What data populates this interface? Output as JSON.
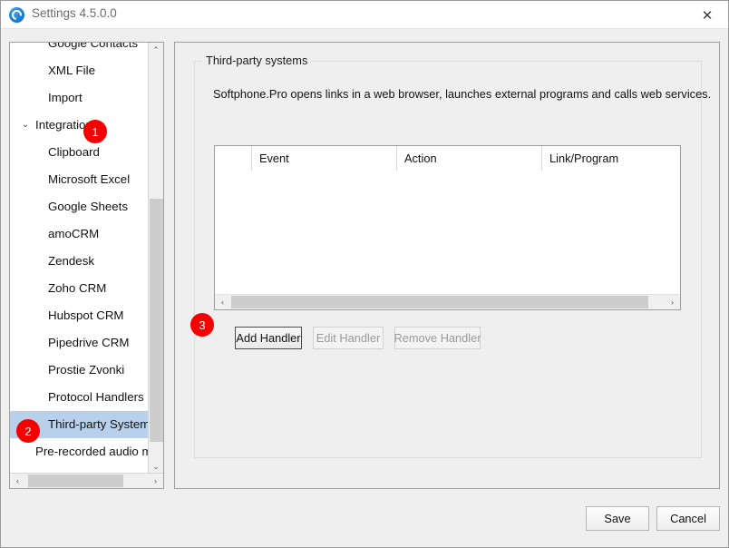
{
  "window": {
    "title": "Settings 4.5.0.0",
    "app_icon": "headset-icon",
    "close_label": "✕"
  },
  "sidebar": {
    "items": [
      {
        "label": "Google Contacts",
        "level": 1,
        "chevron": "",
        "selected": false
      },
      {
        "label": "XML File",
        "level": 1,
        "chevron": "",
        "selected": false
      },
      {
        "label": "Import",
        "level": 1,
        "chevron": "",
        "selected": false
      },
      {
        "label": "Integration",
        "level": 0,
        "chevron": "⌄",
        "selected": false
      },
      {
        "label": "Clipboard",
        "level": 1,
        "chevron": "",
        "selected": false
      },
      {
        "label": "Microsoft Excel",
        "level": 1,
        "chevron": "",
        "selected": false
      },
      {
        "label": "Google Sheets",
        "level": 1,
        "chevron": "",
        "selected": false
      },
      {
        "label": "amoCRM",
        "level": 1,
        "chevron": "",
        "selected": false
      },
      {
        "label": "Zendesk",
        "level": 1,
        "chevron": "",
        "selected": false
      },
      {
        "label": "Zoho CRM",
        "level": 1,
        "chevron": "",
        "selected": false
      },
      {
        "label": "Hubspot CRM",
        "level": 1,
        "chevron": "",
        "selected": false
      },
      {
        "label": "Pipedrive CRM",
        "level": 1,
        "chevron": "",
        "selected": false
      },
      {
        "label": "Prostie Zvonki",
        "level": 1,
        "chevron": "",
        "selected": false
      },
      {
        "label": "Protocol Handlers",
        "level": 1,
        "chevron": "",
        "selected": false
      },
      {
        "label": "Third-party Systems",
        "level": 1,
        "chevron": "",
        "selected": true
      },
      {
        "label": "Pre-recorded audio messag",
        "level": 0,
        "chevron": "",
        "selected": false
      }
    ],
    "scroll_up_icon": "⌃",
    "scroll_down_icon": "⌄",
    "scroll_left_icon": "‹",
    "scroll_right_icon": "›"
  },
  "content": {
    "groupbox_label": "Third-party systems",
    "description": "Softphone.Pro opens links in a web browser, launches external programs and calls web services.",
    "table": {
      "columns": [
        "",
        "Event",
        "Action",
        "Link/Program"
      ],
      "rows": [],
      "scroll_left_icon": "‹",
      "scroll_right_icon": "›"
    },
    "buttons": {
      "add": "Add Handler",
      "edit": "Edit Handler",
      "remove": "Remove Handler"
    }
  },
  "footer": {
    "save": "Save",
    "cancel": "Cancel"
  },
  "annotations": {
    "badge_1": "1",
    "badge_2": "2",
    "badge_3": "3",
    "badge_color": "#f50000"
  }
}
